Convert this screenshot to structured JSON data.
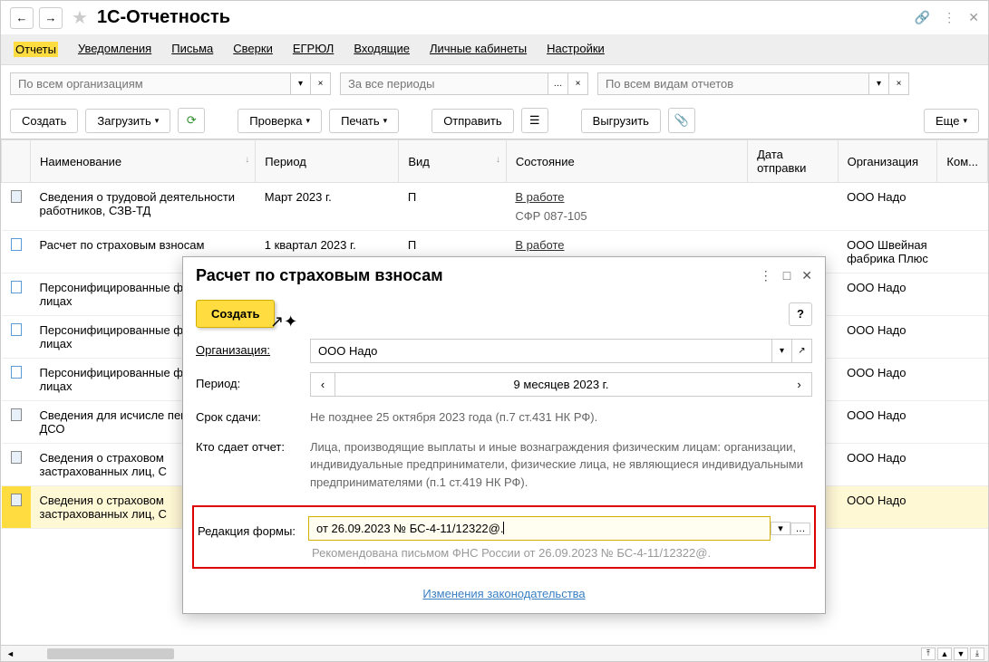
{
  "title": "1С-Отчетность",
  "tabs": [
    "Отчеты",
    "Уведомления",
    "Письма",
    "Сверки",
    "ЕГРЮЛ",
    "Входящие",
    "Личные кабинеты",
    "Настройки"
  ],
  "filters": {
    "org": "По всем организациям",
    "period": "За все периоды",
    "type": "По всем видам отчетов"
  },
  "toolbar": {
    "create": "Создать",
    "load": "Загрузить",
    "check": "Проверка",
    "print": "Печать",
    "send": "Отправить",
    "export": "Выгрузить",
    "more": "Еще"
  },
  "columns": {
    "name": "Наименование",
    "period": "Период",
    "type": "Вид",
    "state": "Состояние",
    "sent": "Дата отправки",
    "org": "Организация",
    "comment": "Ком..."
  },
  "rows": [
    {
      "name": "Сведения о трудовой деятельности работников, СЗВ-ТД",
      "period": "Март 2023 г.",
      "type": "П",
      "state": "В работе",
      "sub": "СФР 087-105",
      "org": "ООО Надо",
      "icon": "filled"
    },
    {
      "name": "Расчет по страховым взносам",
      "period": "1 квартал 2023 г.",
      "type": "П",
      "state": "В работе",
      "org": "ООО Швейная фабрика Плюс",
      "icon": "blank"
    },
    {
      "name": "Персонифицированные физических лицах",
      "org": "ООО Надо",
      "icon": "blank"
    },
    {
      "name": "Персонифицированные физических лицах",
      "org": "ООО Надо",
      "icon": "blank"
    },
    {
      "name": "Персонифицированные физических лицах",
      "org": "ООО Надо",
      "icon": "blank"
    },
    {
      "name": "Сведения для исчисле пенсии, СЗВ-ДСО",
      "org": "ООО Надо",
      "icon": "filled"
    },
    {
      "name": "Сведения о страховом застрахованных лиц, С",
      "org": "ООО Надо",
      "icon": "filled"
    },
    {
      "name": "Сведения о страховом застрахованных лиц, С",
      "org": "ООО Надо",
      "icon": "filled",
      "selected": true
    }
  ],
  "modal": {
    "title": "Расчет по страховым взносам",
    "create": "Создать",
    "help": "?",
    "org_label": "Организация:",
    "org_value": "ООО Надо",
    "period_label": "Период:",
    "period_value": "9 месяцев 2023 г.",
    "deadline_label": "Срок сдачи:",
    "deadline_value": "Не позднее 25 октября 2023 года (п.7 ст.431 НК РФ).",
    "who_label": "Кто сдает отчет:",
    "who_value": "Лица, производящие выплаты и иные вознаграждения физическим лицам: организации, индивидуальные предприниматели, физические лица, не являющиеся индивидуальными предпринимателями (п.1 ст.419 НК РФ).",
    "edition_label": "Редакция формы:",
    "edition_value": "от 26.09.2023 № БС-4-11/12322@.",
    "recom": "Рекомендована письмом ФНС России от 26.09.2023 № БС-4-11/12322@.",
    "law_link": "Изменения законодательства"
  }
}
